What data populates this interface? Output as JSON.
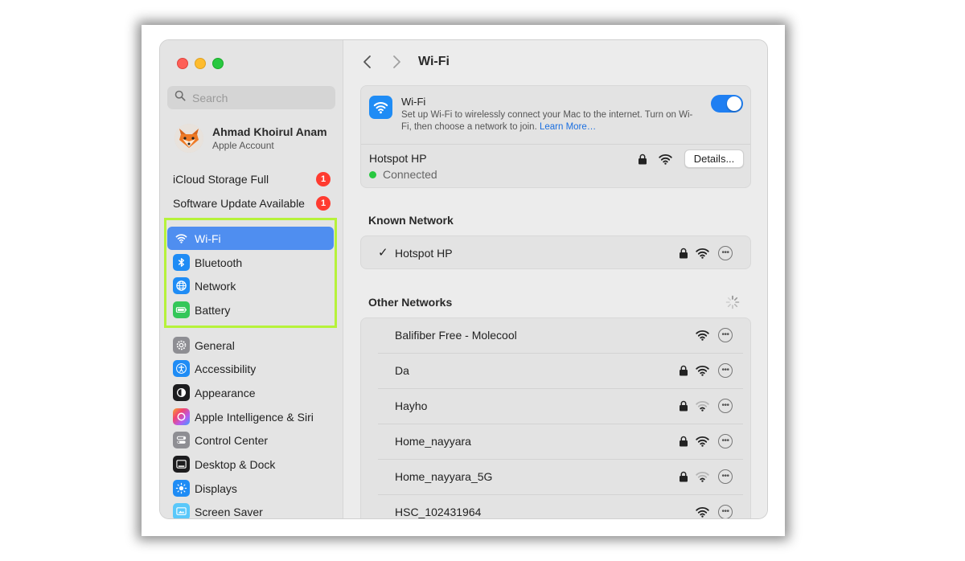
{
  "sidebar": {
    "search_placeholder": "Search",
    "account": {
      "name": "Ahmad Khoirul Anam",
      "subtitle": "Apple Account"
    },
    "notices": [
      {
        "label": "iCloud Storage Full",
        "badge": "1"
      },
      {
        "label": "Software Update Available",
        "badge": "1"
      }
    ],
    "items": [
      {
        "label": "Wi-Fi",
        "icon": "wifi-icon",
        "color": "#1f8cf5"
      },
      {
        "label": "Bluetooth",
        "icon": "bluetooth-icon",
        "color": "#1f8cf5"
      },
      {
        "label": "Network",
        "icon": "globe-icon",
        "color": "#1f8cf5"
      },
      {
        "label": "Battery",
        "icon": "battery-icon",
        "color": "#34c759"
      },
      {
        "label": "General",
        "icon": "gear-icon",
        "color": "#8e8e93"
      },
      {
        "label": "Accessibility",
        "icon": "accessibility-icon",
        "color": "#1f8cf5"
      },
      {
        "label": "Appearance",
        "icon": "appearance-icon",
        "color": "#1c1c1e"
      },
      {
        "label": "Apple Intelligence & Siri",
        "icon": "siri-icon",
        "color": "#b45cf0"
      },
      {
        "label": "Control Center",
        "icon": "control-center-icon",
        "color": "#8e8e93"
      },
      {
        "label": "Desktop & Dock",
        "icon": "dock-icon",
        "color": "#1c1c1e"
      },
      {
        "label": "Displays",
        "icon": "sun-icon",
        "color": "#1f8cf5"
      },
      {
        "label": "Screen Saver",
        "icon": "screen-saver-icon",
        "color": "#5ac8fa"
      }
    ]
  },
  "header": {
    "title": "Wi-Fi"
  },
  "wifi": {
    "title": "Wi-Fi",
    "description": "Set up Wi-Fi to wirelessly connect your Mac to the internet. Turn on Wi-Fi, then choose a network to join.",
    "learn_more": "Learn More…",
    "enabled": true,
    "current_network": "Hotspot HP",
    "status": "Connected",
    "details_label": "Details..."
  },
  "known": {
    "title": "Known Network",
    "networks": [
      {
        "name": "Hotspot HP",
        "locked": true,
        "checked": true
      }
    ]
  },
  "other": {
    "title": "Other Networks",
    "networks": [
      {
        "name": "Balifiber Free - Molecool",
        "locked": false,
        "signal": "strong"
      },
      {
        "name": "Da",
        "locked": true,
        "signal": "strong"
      },
      {
        "name": "Hayho",
        "locked": true,
        "signal": "weak"
      },
      {
        "name": "Home_nayyara",
        "locked": true,
        "signal": "strong"
      },
      {
        "name": "Home_nayyara_5G",
        "locked": true,
        "signal": "weak"
      },
      {
        "name": "HSC_102431964",
        "locked": false,
        "signal": "strong"
      }
    ]
  },
  "colors": {
    "accent": "#1f7ff2",
    "selection": "#4f8ef0",
    "highlight_border": "#b6f23a",
    "badge": "#ff3b30"
  }
}
